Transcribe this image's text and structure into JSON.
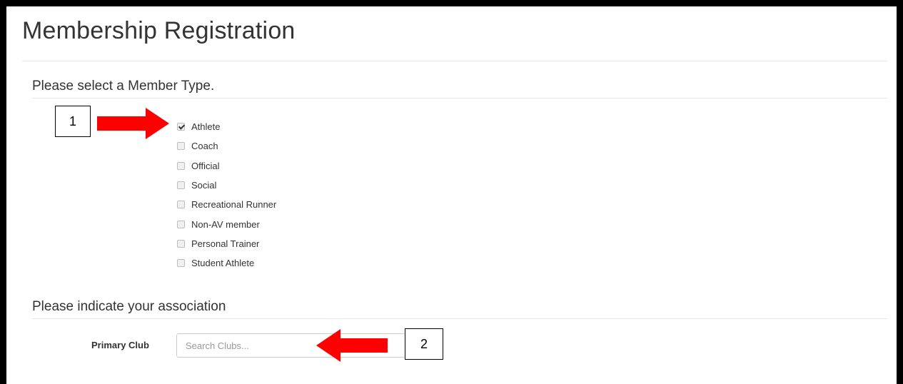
{
  "page": {
    "title": "Membership Registration"
  },
  "member_type": {
    "heading": "Please select a Member Type.",
    "options": [
      {
        "label": "Athlete",
        "checked": true
      },
      {
        "label": "Coach",
        "checked": false
      },
      {
        "label": "Official",
        "checked": false
      },
      {
        "label": "Social",
        "checked": false
      },
      {
        "label": "Recreational Runner",
        "checked": false
      },
      {
        "label": "Non-AV member",
        "checked": false
      },
      {
        "label": "Personal Trainer",
        "checked": false
      },
      {
        "label": "Student Athlete",
        "checked": false
      }
    ]
  },
  "association": {
    "heading": "Please indicate your association",
    "primary_club_label": "Primary Club",
    "primary_club_placeholder": "Search Clubs...",
    "primary_club_value": ""
  },
  "annotations": {
    "callout_1": "1",
    "callout_2": "2",
    "arrow_color": "#ff0000"
  }
}
